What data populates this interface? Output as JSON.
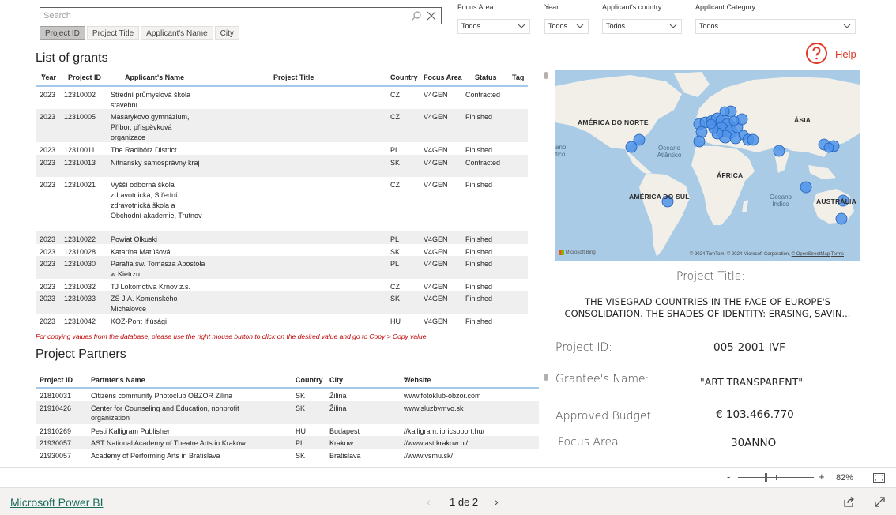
{
  "search": {
    "placeholder": "Search",
    "value": ""
  },
  "search_tabs": [
    "Project ID",
    "Project Title",
    "Applicant's Name",
    "City"
  ],
  "slicers": [
    {
      "label": "Focus Area",
      "value": "Todos"
    },
    {
      "label": "Year",
      "value": "Todos"
    },
    {
      "label": "Applicant's country",
      "value": "Todos"
    },
    {
      "label": "Applicant Category",
      "value": "Todos"
    }
  ],
  "help": {
    "label": "Help",
    "icon": "question-circle-icon",
    "color": "#e03a26"
  },
  "grants": {
    "title": "List of grants",
    "columns": {
      "year": "Year",
      "project_id": "Project ID",
      "applicant": "Applicant's Name",
      "project_title": "Project Title",
      "country": "Country",
      "focus_area": "Focus Area",
      "status": "Status",
      "tag": "Tag"
    },
    "rows": [
      {
        "year": "2023",
        "id": "12310002",
        "applicant": "Střední průmyslová škola stavební",
        "country": "CZ",
        "focus": "V4GEN",
        "status": "Contracted"
      },
      {
        "year": "2023",
        "id": "12310005",
        "applicant": "Masarykovo gymnázium, Příbor, příspěvková organizace",
        "country": "CZ",
        "focus": "V4GEN",
        "status": "Finished"
      },
      {
        "year": "2023",
        "id": "12310011",
        "applicant": "The Racibórz District",
        "country": "PL",
        "focus": "V4GEN",
        "status": "Finished"
      },
      {
        "year": "2023",
        "id": "12310013",
        "applicant": "Nitriansky samosprávny kraj",
        "country": "SK",
        "focus": "V4GEN",
        "status": "Contracted"
      },
      {
        "year": "2023",
        "id": "12310021",
        "applicant": "Vyšší odborná škola zdravotnická, Střední zdravotnická škola a Obchodní akademie, Trutnov",
        "country": "CZ",
        "focus": "V4GEN",
        "status": "Finished"
      },
      {
        "year": "2023",
        "id": "12310022",
        "applicant": "Powiat Olkuski",
        "country": "PL",
        "focus": "V4GEN",
        "status": "Finished"
      },
      {
        "year": "2023",
        "id": "12310028",
        "applicant": "Katarína Matúšová",
        "country": "SK",
        "focus": "V4GEN",
        "status": "Finished"
      },
      {
        "year": "2023",
        "id": "12310030",
        "applicant": "Parafia św. Tomasza Apostoła w Kietrzu",
        "country": "PL",
        "focus": "V4GEN",
        "status": "Finished"
      },
      {
        "year": "2023",
        "id": "12310032",
        "applicant": "TJ Lokomotiva Krnov z.s.",
        "country": "CZ",
        "focus": "V4GEN",
        "status": "Finished"
      },
      {
        "year": "2023",
        "id": "12310033",
        "applicant": "ZŠ J.A. Komenského Michalovce",
        "country": "SK",
        "focus": "V4GEN",
        "status": "Finished"
      },
      {
        "year": "2023",
        "id": "12310042",
        "applicant": "KÖZ-Pont Ifjúsági",
        "country": "HU",
        "focus": "V4GEN",
        "status": "Finished"
      }
    ]
  },
  "copy_note": "For copying values from the database, please use the right mouse button to click on the desired value and go to Copy > Copy value.",
  "partners": {
    "title": "Project Partners",
    "columns": {
      "project_id": "Project ID",
      "name": "Partnter's Name",
      "country": "Country",
      "city": "City",
      "website": "Website"
    },
    "rows": [
      {
        "id": "21810031",
        "name": "Citizens community Photoclub OBZOR Zilina",
        "country": "SK",
        "city": "Žilina",
        "website": " www.fotoklub-obzor.com"
      },
      {
        "id": "21910426",
        "name": "Center for Counseling and Education, nonprofit organization",
        "country": "SK",
        "city": "Žilina",
        "website": " www.sluzbymvo.sk"
      },
      {
        "id": "21910269",
        "name": "Pesti Kalligram Publisher",
        "country": "HU",
        "city": "Budapest",
        "website": "//kalligram.libricsoport.hu/"
      },
      {
        "id": "21930057",
        "name": "AST National Academy of Theatre Arts in Kraków",
        "country": "PL",
        "city": "Krakow",
        "website": "//www.ast.krakow.pl/"
      },
      {
        "id": "21930057",
        "name": "Academy of Performing Arts in Bratislava",
        "country": "SK",
        "city": "Bratislava",
        "website": "//www.vsmu.sk/"
      }
    ]
  },
  "map": {
    "labels": {
      "north_america": "AMÉRICA DO NORTE",
      "asia": "ÁSIA",
      "africa": "ÁFRICA",
      "south_america": "AMÉRICA DO SUL",
      "australia": "AUSTRÁLIA",
      "atlantic": "Oceano Atlântico",
      "indian": "Oceano Índico",
      "pacific_partial": "ano fico"
    },
    "bing": "Microsoft Bing",
    "copyright": "© 2024 TomTom, © 2024 Microsoft Corporation, ",
    "osm": "© OpenStreetMap",
    "terms": "Terms",
    "bubble_color": "#4f93ea"
  },
  "project": {
    "title_label": "Project Title:",
    "title_line1": "THE VISEGRAD COUNTRIES IN THE FACE OF EUROPE'S",
    "title_line2": "CONSOLIDATION. THE SHADES OF IDENTITY: ERASING, SAVIN...",
    "id_label": "Project ID:",
    "id_value": "005-2001-IVF",
    "grantee_label": "Grantee's Name:",
    "grantee_value": "\"ART TRANSPARENT\"",
    "budget_label": "Approved Budget:",
    "budget_value": "€ 103.466.770",
    "focus_label": "Focus Area",
    "focus_value": "30ANNO"
  },
  "zoom": {
    "minus": "-",
    "plus": "+",
    "level": "82%",
    "slider_fraction": 0.35
  },
  "footer": {
    "link": "Microsoft Power BI",
    "page": "1 de 2",
    "prev": "‹",
    "next": "›"
  }
}
